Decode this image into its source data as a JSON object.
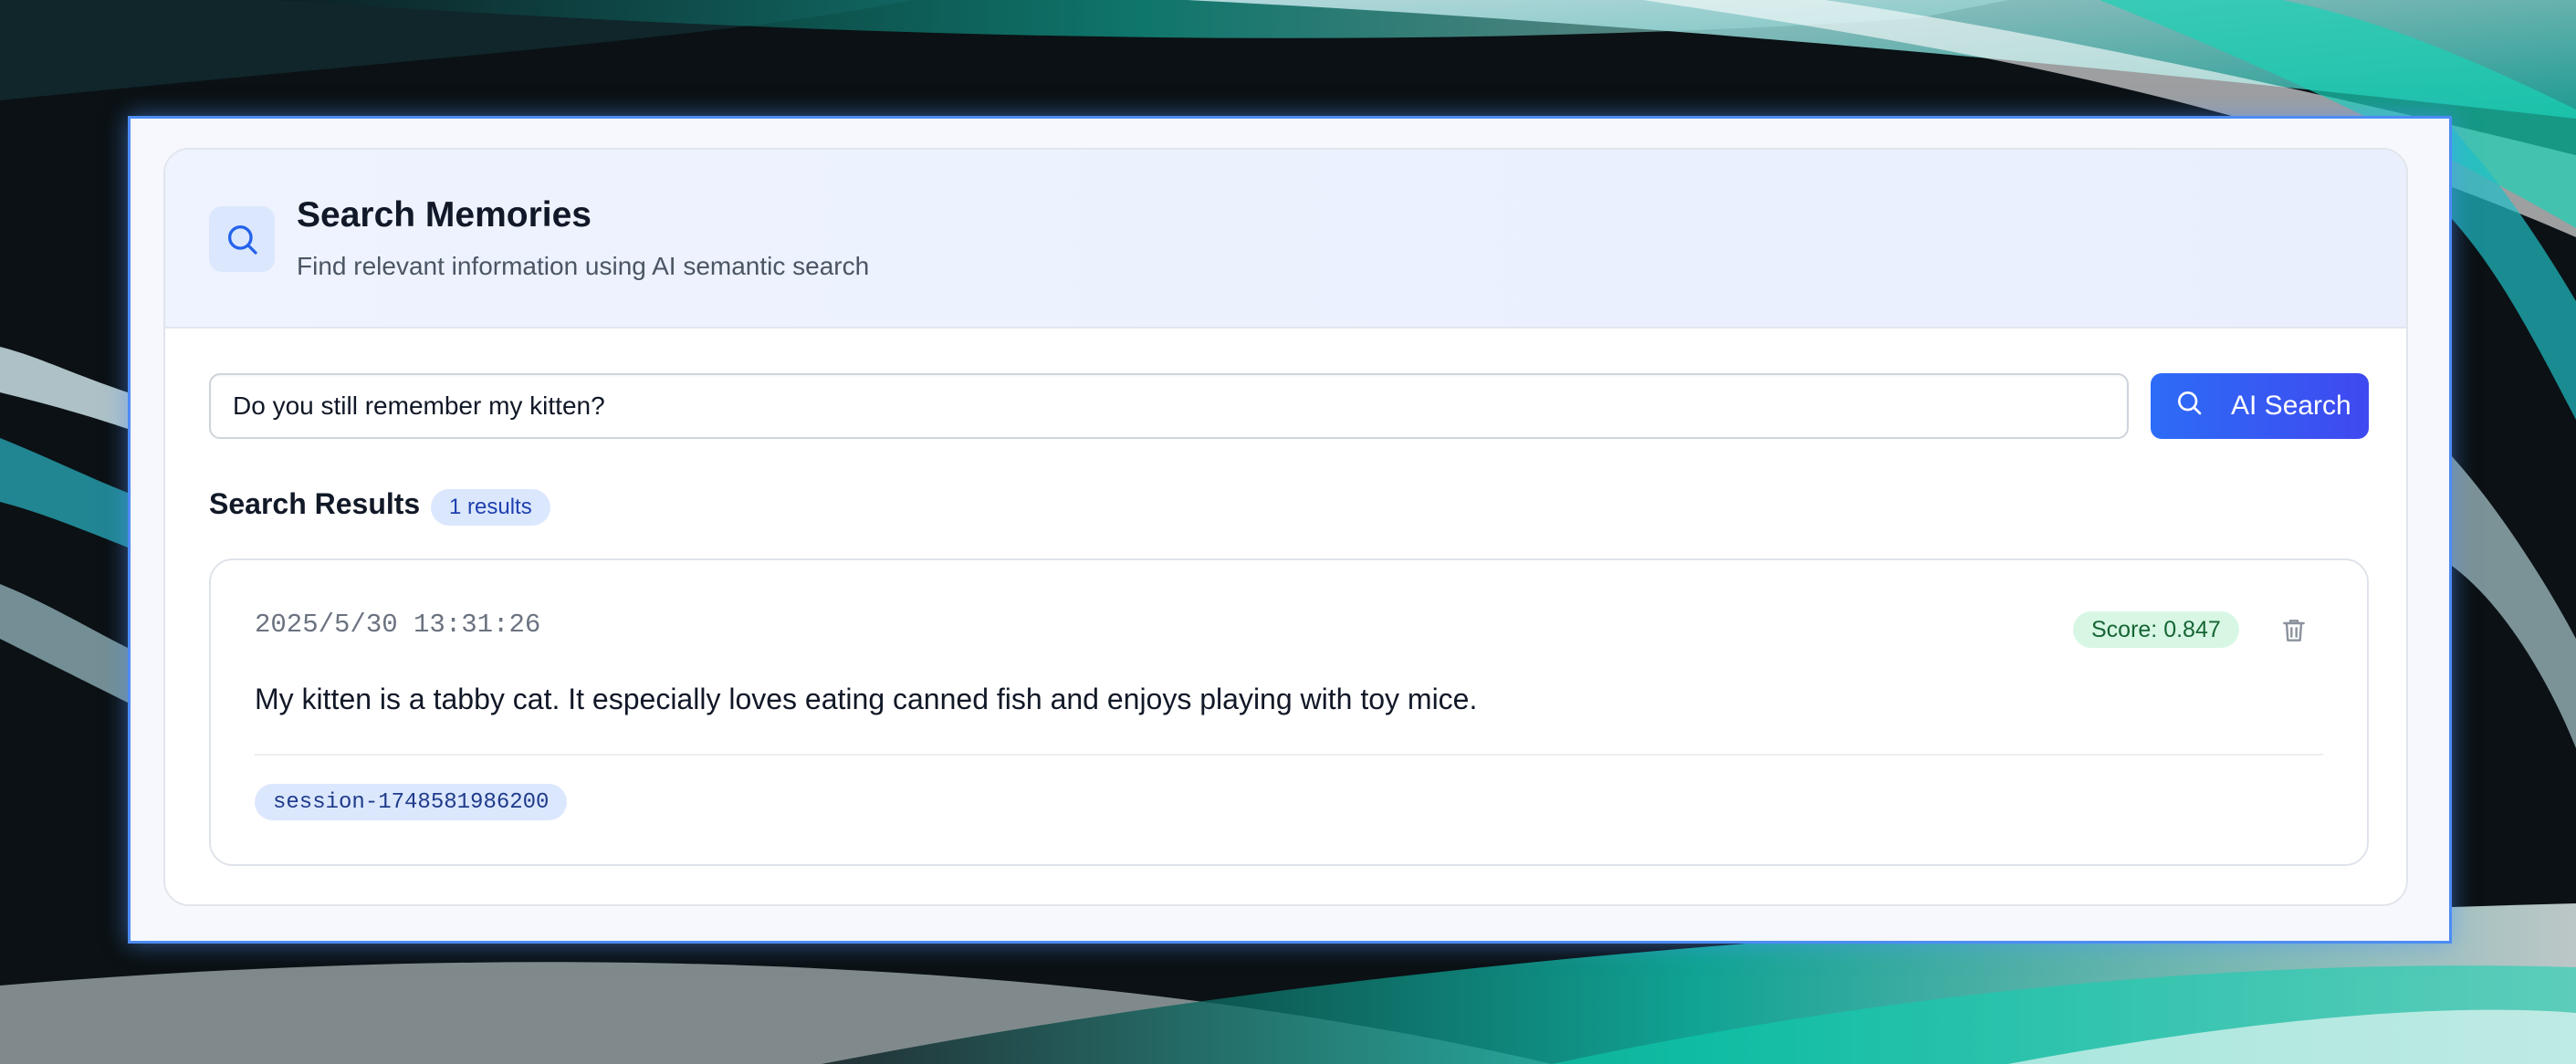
{
  "panel": {
    "title": "Search Memories",
    "subtitle": "Find relevant information using AI semantic search"
  },
  "search": {
    "query": "Do you still remember my kitten?",
    "button_label": "AI Search"
  },
  "results": {
    "heading": "Search Results",
    "count_badge": "1 results",
    "items": [
      {
        "timestamp": "2025/5/30 13:31:26",
        "score": "Score: 0.847",
        "content": "My kitten is a tabby cat. It especially loves eating canned fish and enjoys playing with toy mice.",
        "session": "session-1748581986200"
      }
    ]
  },
  "icons": {
    "header": "search-icon",
    "button": "search-icon",
    "delete": "trash-icon"
  },
  "colors": {
    "accent": "#2d6cf6",
    "accent_end": "#3f49f0",
    "score_bg": "#d7f7e4",
    "score_text": "#166534",
    "badge_bg": "#dbe7fd"
  }
}
